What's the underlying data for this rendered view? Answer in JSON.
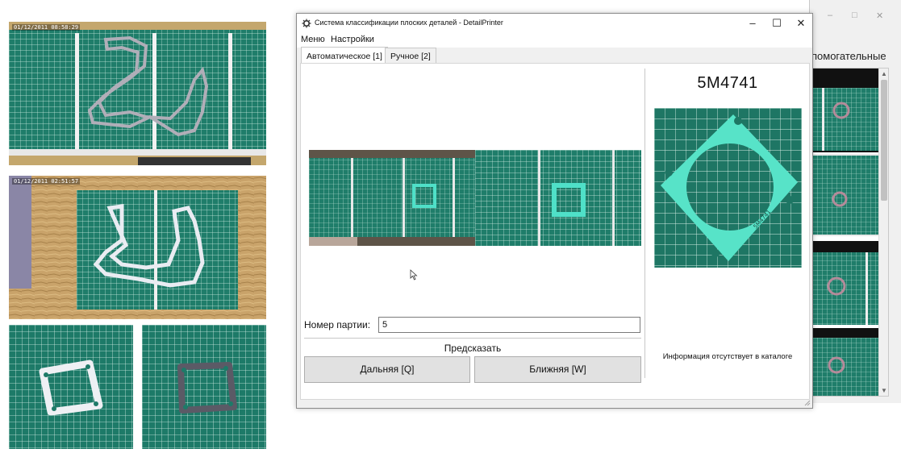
{
  "left_photos": {
    "photo1_timestamp": "01/12/2011 08:58:29",
    "photo2_timestamp": "01/12/2011 02:51:57"
  },
  "background_window": {
    "minimize_glyph": "–",
    "maximize_glyph": "□",
    "close_glyph": "✕",
    "tab_label_fragment": "помогательные"
  },
  "main_window": {
    "title": "Система классификации плоских деталей - DetailPrinter",
    "title_icon": "gear-icon",
    "controls": {
      "minimize": "–",
      "maximize": "☐",
      "close": "✕"
    },
    "menu": [
      {
        "label": "Меню"
      },
      {
        "label": "Настройки"
      }
    ],
    "tabs": [
      {
        "label": "Автоматическое [1]",
        "active": true
      },
      {
        "label": "Ручное [2]",
        "active": false
      }
    ],
    "form": {
      "batch_label": "Номер партии:",
      "batch_value": "5",
      "predict_label": "Предсказать",
      "far_button": "Дальняя [Q]",
      "near_button": "Ближняя [W]"
    },
    "result": {
      "part_code": "5M4741",
      "catalog_info": "Информация отсутствует в каталоге",
      "part_stamp": "5M4741"
    }
  },
  "colors": {
    "mat_green": "#1f7d6a",
    "grid_line": "#d6efe6",
    "gasket_cyan": "#4fe0c8",
    "gasket_white": "#e9ecf2",
    "wood": "#c9a36a"
  }
}
